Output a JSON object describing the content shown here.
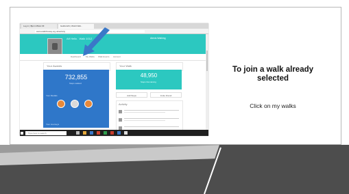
{
  "slide": {
    "title": "To join a walk already selected",
    "subtitle": "Click on my walks"
  },
  "screenshot": {
    "tabs": [
      "Log in | Bjorn Mbok Oll",
      "Goldsmith | World Wal..."
    ],
    "address": "www.walkthisway.org.uk/activity",
    "header_name": "Atf Hello . Walk 1012",
    "user_label": "Alexis Walking",
    "nav_items": [
      "Dashboard",
      "My Walks",
      "Walk Events",
      "Account"
    ],
    "your_awards_title": "Your Awards",
    "your_awards_value": "732,855",
    "your_awards_caption": "Steps walked",
    "your_awards_sub": "Your Medals",
    "your_awards_footer": "Your Journeys",
    "your_walk_title": "Your Walk",
    "your_walk_value": "48,950",
    "your_walk_caption": "Steps Remaining",
    "btn_left": "Add Steps",
    "btn_right": "Invite Friend",
    "activity_title": "Activity",
    "search_placeholder": "Type here to search"
  },
  "colors": {
    "teal": "#2cc8c0",
    "blue": "#2f77c9",
    "medal_orange": "#e8893a",
    "medal_silver": "#d9d9d9",
    "arrow": "#3a78c8",
    "band_dark": "#4d4d4d",
    "band_gray": "#9b9b9b",
    "band_light": "#c9c9c9"
  },
  "icons": [
    "pointer-arrow-icon",
    "medal-icon",
    "windows-start-icon",
    "taskbar-app-icon"
  ]
}
